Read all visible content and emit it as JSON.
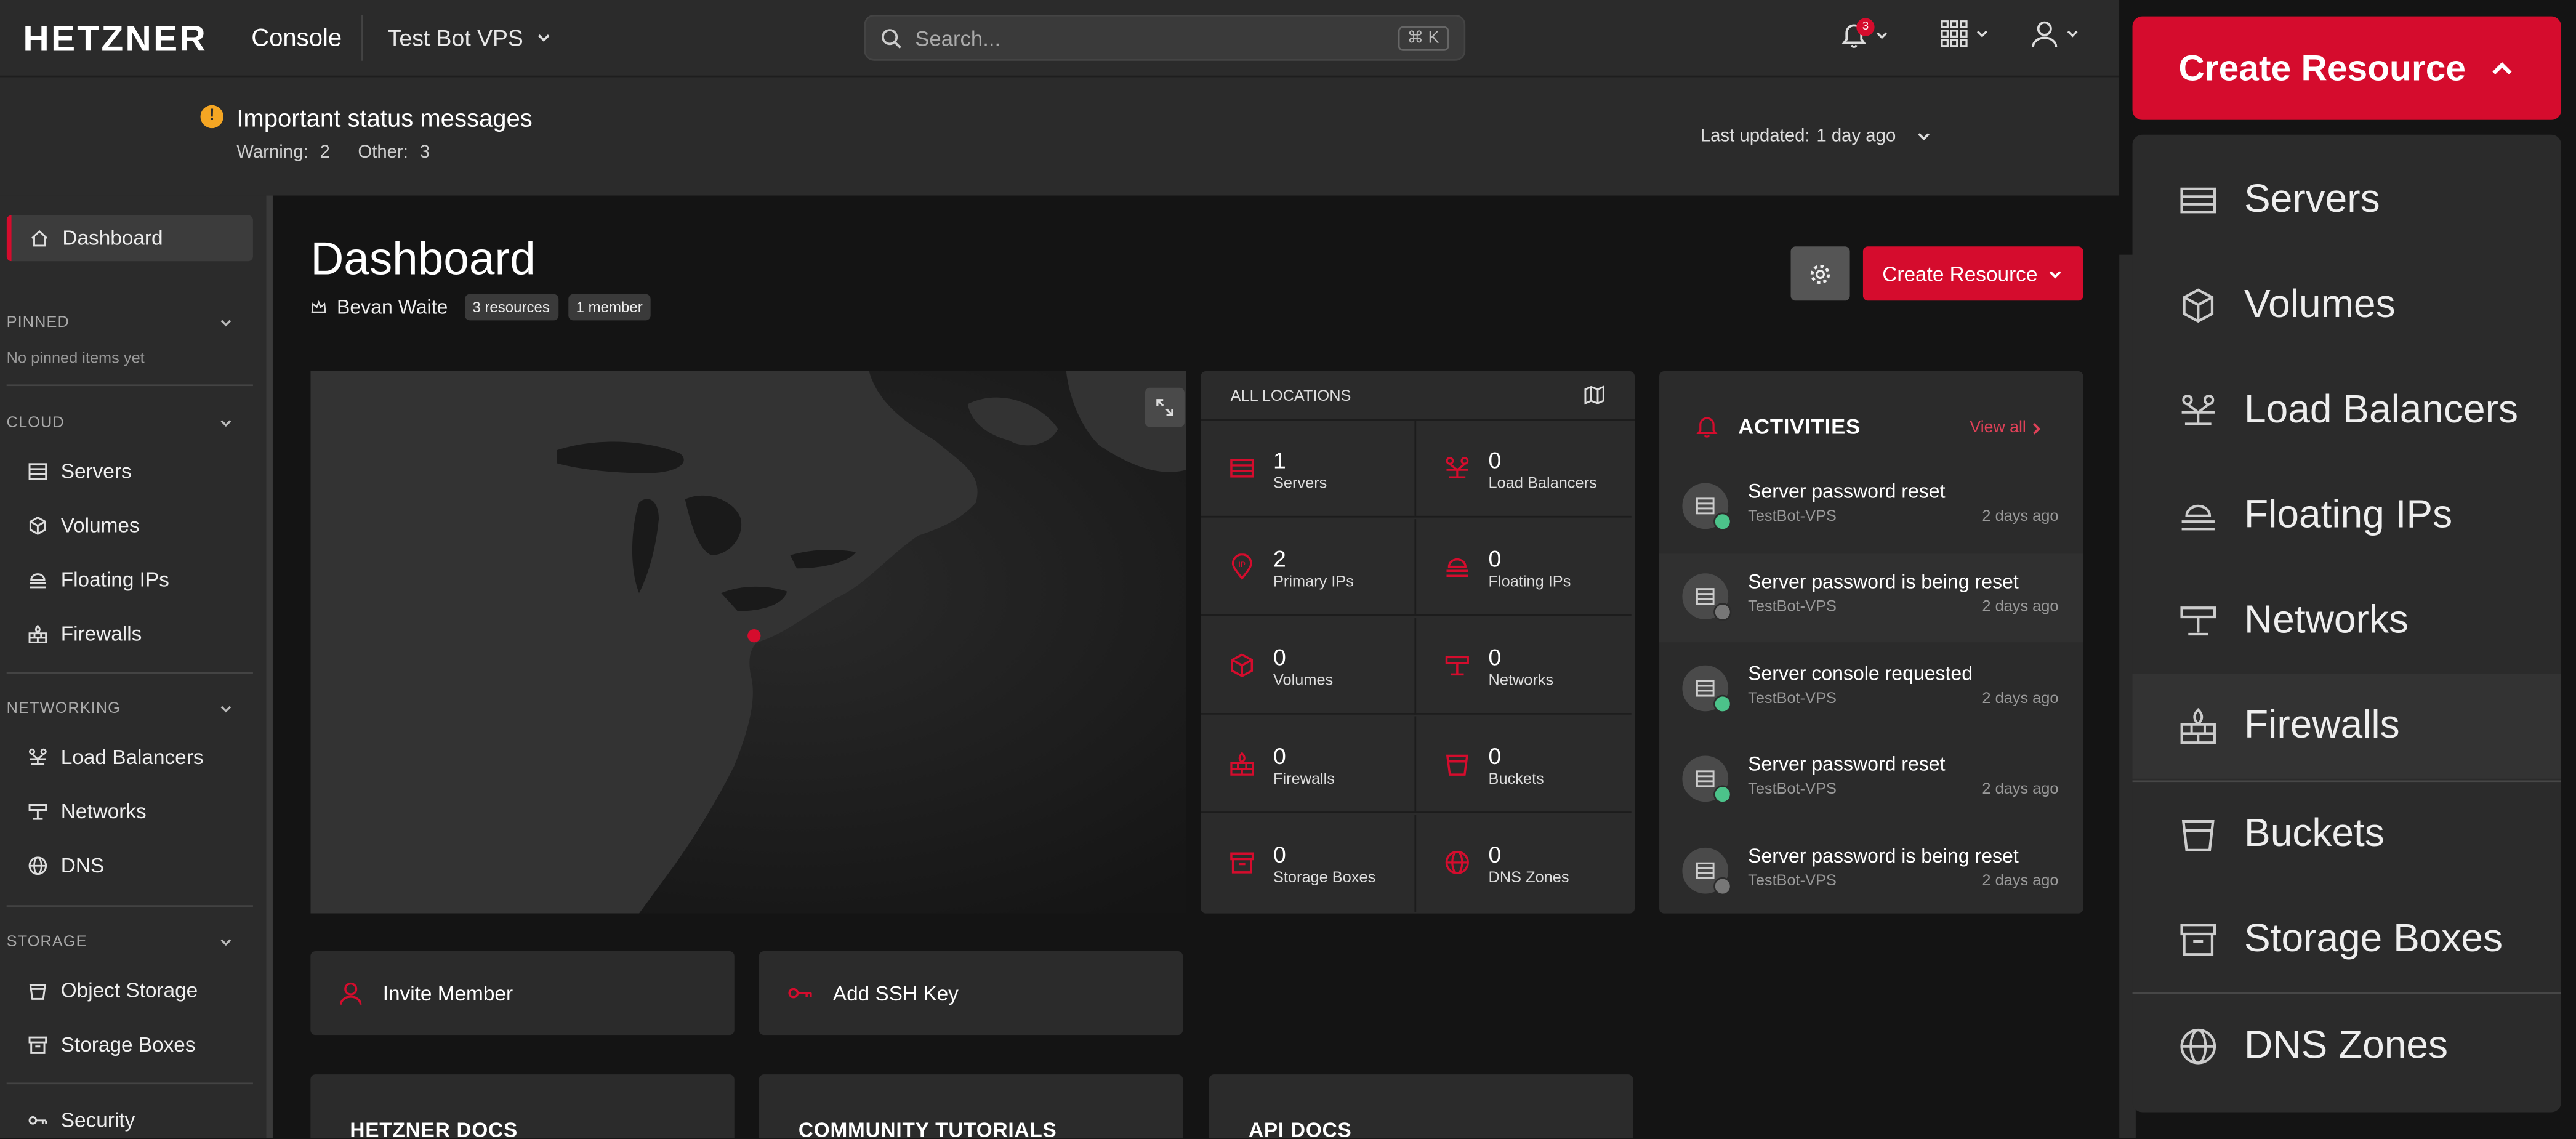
{
  "header": {
    "logo": "HETZNER",
    "logo_sub": "Console",
    "project": "Test Bot VPS",
    "search_placeholder": "Search...",
    "search_shortcut": "⌘ K",
    "notification_count": "3"
  },
  "status": {
    "title": "Important status messages",
    "warning_label": "Warning:",
    "warning_count": "2",
    "other_label": "Other:",
    "other_count": "3",
    "updated_label": "Last updated:",
    "updated_value": "1 day ago"
  },
  "sidebar": {
    "dashboard": "Dashboard",
    "pinned_title": "PINNED",
    "pinned_empty": "No pinned items yet",
    "cloud_title": "CLOUD",
    "cloud_items": [
      "Servers",
      "Volumes",
      "Floating IPs",
      "Firewalls"
    ],
    "networking_title": "NETWORKING",
    "networking_items": [
      "Load Balancers",
      "Networks",
      "DNS"
    ],
    "storage_title": "STORAGE",
    "storage_items": [
      "Object Storage",
      "Storage Boxes"
    ],
    "security": "Security"
  },
  "main": {
    "title": "Dashboard",
    "owner": "Bevan Waite",
    "resources_badge": "3 resources",
    "members_badge": "1 member",
    "create_label": "Create Resource"
  },
  "locations": {
    "title": "ALL LOCATIONS",
    "cells": [
      {
        "count": "1",
        "label": "Servers"
      },
      {
        "count": "0",
        "label": "Load Balancers"
      },
      {
        "count": "2",
        "label": "Primary IPs"
      },
      {
        "count": "0",
        "label": "Floating IPs"
      },
      {
        "count": "0",
        "label": "Volumes"
      },
      {
        "count": "0",
        "label": "Networks"
      },
      {
        "count": "0",
        "label": "Firewalls"
      },
      {
        "count": "0",
        "label": "Buckets"
      },
      {
        "count": "0",
        "label": "Storage Boxes"
      },
      {
        "count": "0",
        "label": "DNS Zones"
      }
    ]
  },
  "activities": {
    "title": "ACTIVITIES",
    "view_all": "View all",
    "items": [
      {
        "name": "Server password reset",
        "server": "TestBot-VPS",
        "time": "2 days ago",
        "status": "ok"
      },
      {
        "name": "Server password is being reset",
        "server": "TestBot-VPS",
        "time": "2 days ago",
        "status": "pending"
      },
      {
        "name": "Server console requested",
        "server": "TestBot-VPS",
        "time": "2 days ago",
        "status": "ok"
      },
      {
        "name": "Server password reset",
        "server": "TestBot-VPS",
        "time": "2 days ago",
        "status": "ok"
      },
      {
        "name": "Server password is being reset",
        "server": "TestBot-VPS",
        "time": "2 days ago",
        "status": "pending"
      }
    ]
  },
  "quick_actions": {
    "invite": "Invite Member",
    "ssh": "Add SSH Key"
  },
  "bottom_cards": [
    "HETZNER DOCS",
    "COMMUNITY TUTORIALS",
    "API DOCS"
  ],
  "dropdown": {
    "button_label": "Create Resource",
    "items": [
      "Servers",
      "Volumes",
      "Load Balancers",
      "Floating IPs",
      "Networks",
      "Firewalls",
      "Buckets",
      "Storage Boxes",
      "DNS Zones"
    ],
    "hovered": "Firewalls"
  },
  "colors": {
    "accent": "#d50c2d",
    "background": "#141414",
    "panel": "#2b2b2b",
    "warning": "#f5a623",
    "success": "#4cc38a"
  }
}
